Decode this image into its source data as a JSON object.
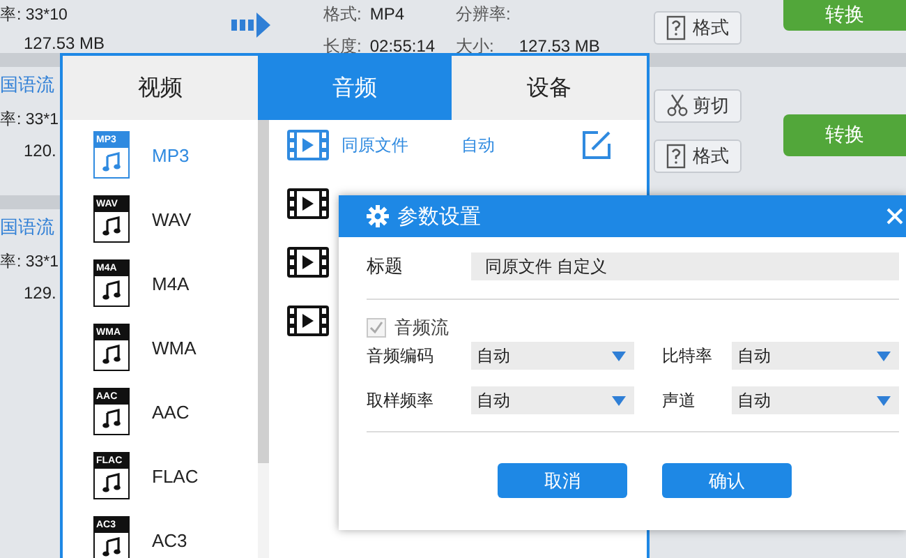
{
  "file_rows": [
    {
      "details": [
        "率: 33*10",
        "127.53 MB"
      ],
      "output": {
        "format_label": "格式:",
        "format": "MP4",
        "resolution_label": "分辨率:",
        "duration_label": "长度:",
        "duration": "02:55:14",
        "size_label": "大小:",
        "size": "127.53 MB"
      },
      "actions": [
        {
          "kind": "format",
          "label": "格式"
        }
      ],
      "convert": "转换"
    },
    {
      "name": "国语流",
      "details": [
        "率: 33*1",
        "120."
      ],
      "actions": [
        {
          "kind": "cut",
          "label": "剪切"
        },
        {
          "kind": "format",
          "label": "格式"
        }
      ],
      "convert": "转换"
    },
    {
      "name": "国语流",
      "details": [
        "率: 33*1",
        "129."
      ]
    }
  ],
  "format_panel": {
    "tabs": [
      {
        "label": "视频",
        "selected": false
      },
      {
        "label": "音频",
        "selected": true
      },
      {
        "label": "设备",
        "selected": false
      }
    ],
    "formats": [
      {
        "badge": "MP3",
        "label": "MP3",
        "selected": true
      },
      {
        "badge": "WAV",
        "label": "WAV",
        "selected": false
      },
      {
        "badge": "M4A",
        "label": "M4A",
        "selected": false
      },
      {
        "badge": "WMA",
        "label": "WMA",
        "selected": false
      },
      {
        "badge": "AAC",
        "label": "AAC",
        "selected": false
      },
      {
        "badge": "FLAC",
        "label": "FLAC",
        "selected": false
      },
      {
        "badge": "AC3",
        "label": "AC3",
        "selected": false
      }
    ],
    "presets": [
      {
        "kind": "full",
        "name": "同原文件",
        "quality": "自动",
        "selected": true
      },
      {
        "kind": "icon",
        "selected": false
      },
      {
        "kind": "icon",
        "selected": false
      },
      {
        "kind": "icon",
        "selected": false
      }
    ]
  },
  "dialog": {
    "title": "参数设置",
    "title_label": "标题",
    "title_value": "同原文件 自定义",
    "audio_stream": {
      "label": "音频流",
      "checked": true,
      "disabled": true
    },
    "selects": [
      {
        "label": "音频编码",
        "value": "自动"
      },
      {
        "label": "比特率",
        "value": "自动"
      },
      {
        "label": "取样频率",
        "value": "自动"
      },
      {
        "label": "声道",
        "value": "自动"
      }
    ],
    "buttons": [
      "取消",
      "确认"
    ]
  }
}
